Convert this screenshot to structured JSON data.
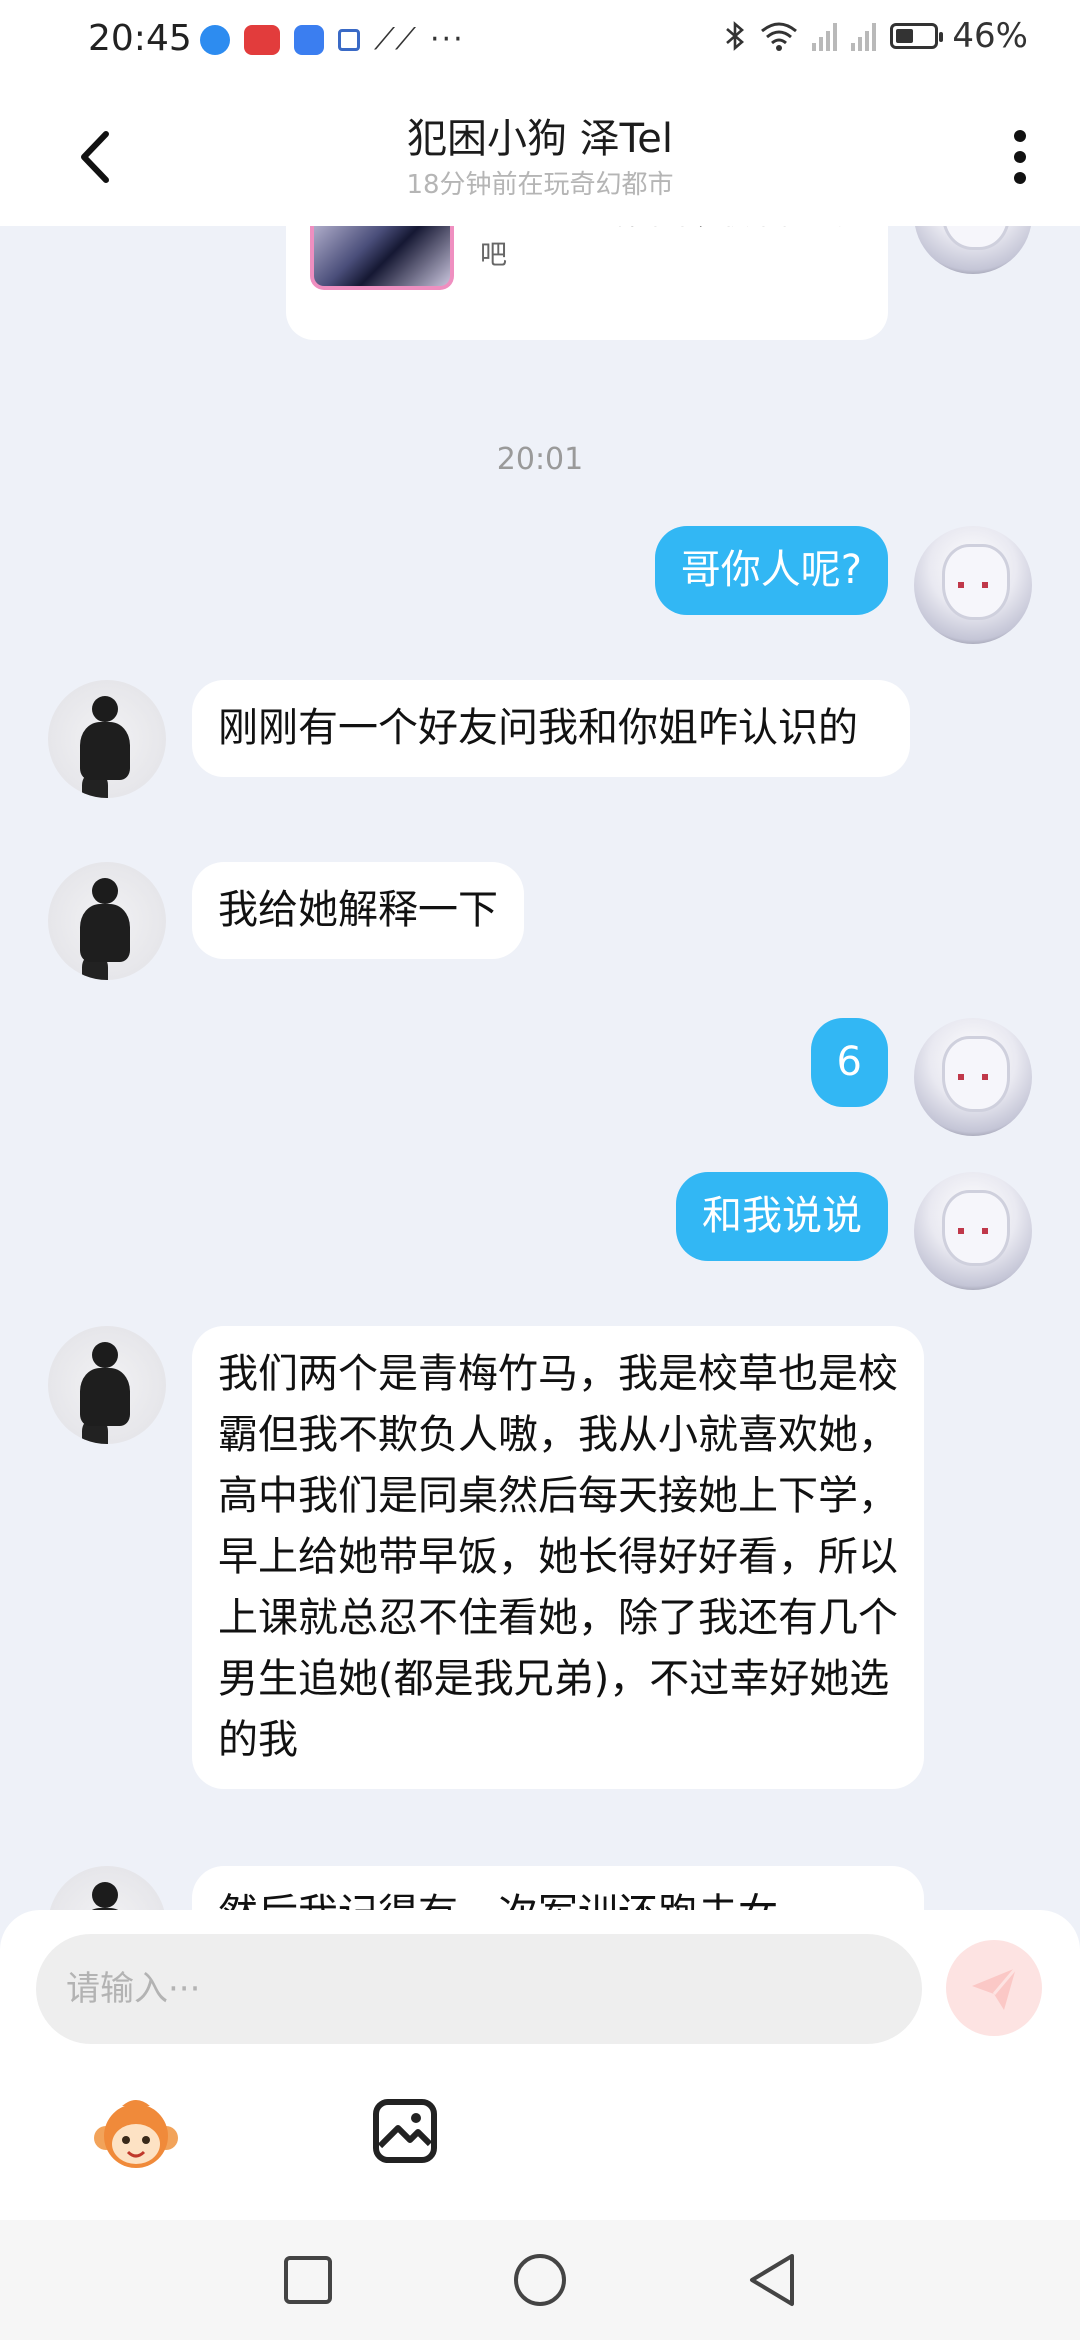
{
  "status_bar": {
    "time": "20:45",
    "more": "···",
    "battery_percent": "46%",
    "battery_level": 0.46
  },
  "header": {
    "title": "犯困小狗 泽Tel",
    "subtitle": "18分钟前在玩奇幻都市"
  },
  "share_card": {
    "text": "我正在奇幻都市中，快来和我玩吧"
  },
  "time_divider": "20:01",
  "messages": [
    {
      "side": "self",
      "text": "哥你人呢?"
    },
    {
      "side": "other",
      "text": "刚刚有一个好友问我和你姐咋认识的"
    },
    {
      "side": "other",
      "text": "我给她解释一下"
    },
    {
      "side": "self",
      "text": "6"
    },
    {
      "side": "self",
      "text": "和我说说"
    },
    {
      "side": "other",
      "text": "我们两个是青梅竹马，我是校草也是校霸但我不欺负人嗷，我从小就喜欢她，高中我们是同桌然后每天接她上下学，早上给她带早饭，她长得好好看，所以上课就总忍不住看她，除了我还有几个男生追她(都是我兄弟)，不过幸好她选的我"
    },
    {
      "side": "other",
      "text": "然后我记得有一次军训还跑去女"
    }
  ],
  "composer": {
    "placeholder": "请输入···"
  },
  "colors": {
    "self_bubble": "#32b7f4",
    "other_bubble": "#ffffff",
    "background": "#eef1f8",
    "send_button": "#fde3e2"
  }
}
